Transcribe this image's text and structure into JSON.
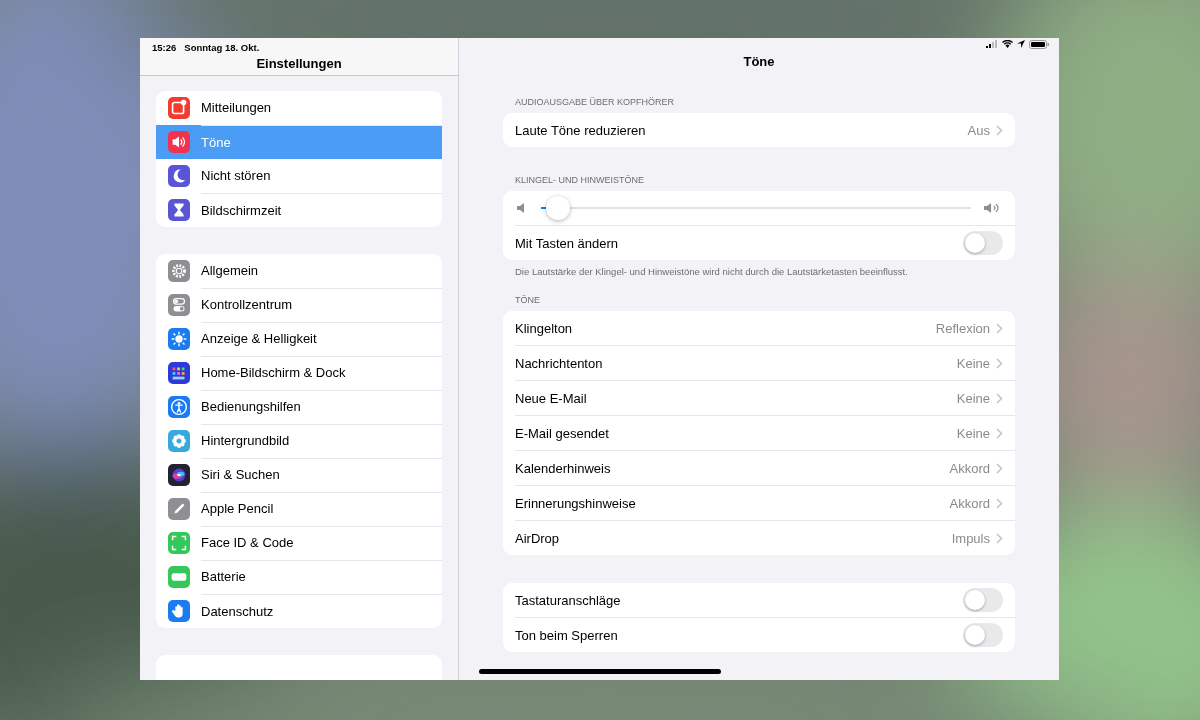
{
  "status_bar": {
    "time": "15:26",
    "date": "Sonntag 18. Okt."
  },
  "sidebar": {
    "title": "Einstellungen",
    "groups": [
      {
        "items": [
          {
            "label": "Mitteilungen",
            "color": "#f23c30",
            "selected": false
          },
          {
            "label": "Töne",
            "color": "#f2334f",
            "selected": true
          },
          {
            "label": "Nicht stören",
            "color": "#5a55d6",
            "selected": false
          },
          {
            "label": "Bildschirmzeit",
            "color": "#5a55d6",
            "selected": false
          }
        ]
      },
      {
        "items": [
          {
            "label": "Allgemein",
            "color": "#8e8e93",
            "selected": false
          },
          {
            "label": "Kontrollzentrum",
            "color": "#8e8e93",
            "selected": false
          },
          {
            "label": "Anzeige & Helligkeit",
            "color": "#1b7cf2",
            "selected": false
          },
          {
            "label": "Home-Bildschirm & Dock",
            "color": "#2d3ad8",
            "selected": false
          },
          {
            "label": "Bedienungshilfen",
            "color": "#1b7cf2",
            "selected": false
          },
          {
            "label": "Hintergrundbild",
            "color": "#36aadc",
            "selected": false
          },
          {
            "label": "Siri & Suchen",
            "color": "#222233",
            "selected": false
          },
          {
            "label": "Apple Pencil",
            "color": "#8e8e93",
            "selected": false
          },
          {
            "label": "Face ID & Code",
            "color": "#34c759",
            "selected": false
          },
          {
            "label": "Batterie",
            "color": "#34c759",
            "selected": false
          },
          {
            "label": "Datenschutz",
            "color": "#1b7cf2",
            "selected": false
          }
        ]
      }
    ]
  },
  "detail": {
    "title": "Töne",
    "sections": [
      {
        "header": "AUDIOAUSGABE ÜBER KOPFHÖRER",
        "rows": [
          {
            "kind": "value",
            "label": "Laute Töne reduzieren",
            "value": "Aus"
          }
        ]
      },
      {
        "header": "KLINGEL- UND HINWEISTÖNE",
        "footer": "Die Lautstärke der Klingel- und Hinweistöne wird nicht durch die Lautstärketasten beeinflusst.",
        "rows": [
          {
            "kind": "slider",
            "level": 0.04
          },
          {
            "kind": "toggle",
            "label": "Mit Tasten ändern",
            "on": false
          }
        ]
      },
      {
        "header": "TÖNE",
        "rows": [
          {
            "kind": "value",
            "label": "Klingelton",
            "value": "Reflexion"
          },
          {
            "kind": "value",
            "label": "Nachrichtenton",
            "value": "Keine"
          },
          {
            "kind": "value",
            "label": "Neue E-Mail",
            "value": "Keine"
          },
          {
            "kind": "value",
            "label": "E-Mail gesendet",
            "value": "Keine"
          },
          {
            "kind": "value",
            "label": "Kalenderhinweis",
            "value": "Akkord"
          },
          {
            "kind": "value",
            "label": "Erinnerungshinweise",
            "value": "Akkord"
          },
          {
            "kind": "value",
            "label": "AirDrop",
            "value": "Impuls"
          }
        ]
      },
      {
        "rows": [
          {
            "kind": "toggle",
            "label": "Tastaturanschläge",
            "on": false
          },
          {
            "kind": "toggle",
            "label": "Ton beim Sperren",
            "on": false
          }
        ]
      }
    ]
  }
}
